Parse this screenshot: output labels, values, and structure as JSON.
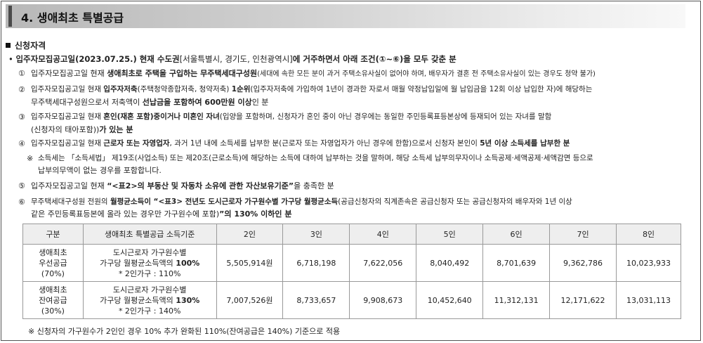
{
  "title": "4. 생애최초 특별공급",
  "section_heading": "신청자격",
  "main_rule": {
    "bullet": "•",
    "a": "입주자모집공고일(2023.07.25.) 현재 수도권",
    "b": "[서울특별시, 경기도, 인천광역시]",
    "c": "에 거주하면서 아래 조건(①~⑥)을 모두 갖춘 분"
  },
  "conditions": [
    {
      "marker": "①",
      "line1": [
        "입주자모집공고일 현재 ",
        "생애최초로 주택을 구입하는 무주택세대구성원",
        "(세대에 속한 모든 분이 과거 주택소유사실이 없어야 하며, 배우자가 결혼 전 주택소유사실이 있는 경우도 청약 불가)"
      ]
    },
    {
      "marker": "②",
      "line1": [
        "입주자모집공고일 현재 ",
        "입주자저축",
        "(주택청약종합저축, 청약저축) ",
        "1순위",
        "(입주자저축에 가입하여 1년이 경과한 자로서 매월 약정납입일에 월 납입금을 12회 이상 납입한 자)에 해당하는"
      ],
      "line2": [
        "무주택세대구성원으로서 저축액이 ",
        "선납금을 포함하여 600만원 이상",
        "인 분"
      ]
    },
    {
      "marker": "③",
      "line1": [
        "입주자모집공고일 현재 ",
        "혼인(재혼 포함)중이거나 미혼인 자녀",
        "(입양을 포함하며, 신청자가 혼인 중이 아닌 경우에는 동일한 주민등록표등본상에 등재되어 있는 자녀를 말함"
      ],
      "line2": [
        "(신청자의 태아포함))",
        "가 있는 분"
      ]
    },
    {
      "marker": "④",
      "line1": [
        "입주자모집공고일 현재 ",
        "근로자 또는 자영업자",
        ", 과거 1년 내에 소득세를 납부한 분(근로자 또는 자영업자가 아닌 경우에 한함)으로서 신청자 본인이 ",
        "5년 이상 소득세를 납부한 분"
      ]
    },
    {
      "marker": "⑤",
      "line1": [
        "입주자모집공고일 현재 ",
        "“<표2>의 부동산 및 자동차 소유에 관한 자산보유기준”",
        "을 충족한 분"
      ]
    },
    {
      "marker": "⑥",
      "line1": [
        "무주택세대구성원 전원의 ",
        "월평균소득이",
        " “",
        "<표3> 전년도 도시근로자 가구원수별 가구당 월평균소득",
        "(공급신청자의 직계존속은 공급신청자 또는 공급신청자의 배우자와 1년 이상"
      ],
      "line2": [
        "같은 주민등록표등본에 올라 있는 경우만 가구원수에 포함)",
        "”의 130% 이하인 분"
      ]
    }
  ],
  "tax_note": {
    "marker": "※",
    "line1": "소득세는 「소득세법」 제19조(사업소득) 또는 제20조(근로소득)에 해당하는 소득에 대하여 납부하는 것을 말하며, 해당 소득세 납부의무자이나 소득공제·세액공제·세액감면 등으로",
    "line2": "납부의무액이 없는 경우를 포함합니다."
  },
  "table": {
    "headers": [
      "구분",
      "생애최초 특별공급 소득기준",
      "2인",
      "3인",
      "4인",
      "5인",
      "6인",
      "7인",
      "8인"
    ],
    "rows": [
      {
        "category": [
          "생애최초",
          "우선공급",
          "(70%)"
        ],
        "criteria": [
          "도시근로자 가구원수별",
          "가구당 월평균소득액의 ",
          "100%",
          "* 2인가구 : 110%"
        ],
        "values": [
          "5,505,914원",
          "6,718,198",
          "7,622,056",
          "8,040,492",
          "8,701,639",
          "9,362,786",
          "10,023,933"
        ]
      },
      {
        "category": [
          "생애최초",
          "잔여공급",
          "(30%)"
        ],
        "criteria": [
          "도시근로자 가구원수별",
          "가구당 월평균소득액의 ",
          "130%",
          "* 2인가구 : 140%"
        ],
        "values": [
          "7,007,526원",
          "8,733,657",
          "9,908,673",
          "10,452,640",
          "11,312,131",
          "12,171,622",
          "13,031,113"
        ]
      }
    ]
  },
  "bottom_note": "※ 신청자의 가구원수가 2인인 경우 10% 추가 완화된 110%(잔여공급은 140%) 기준으로 적용"
}
